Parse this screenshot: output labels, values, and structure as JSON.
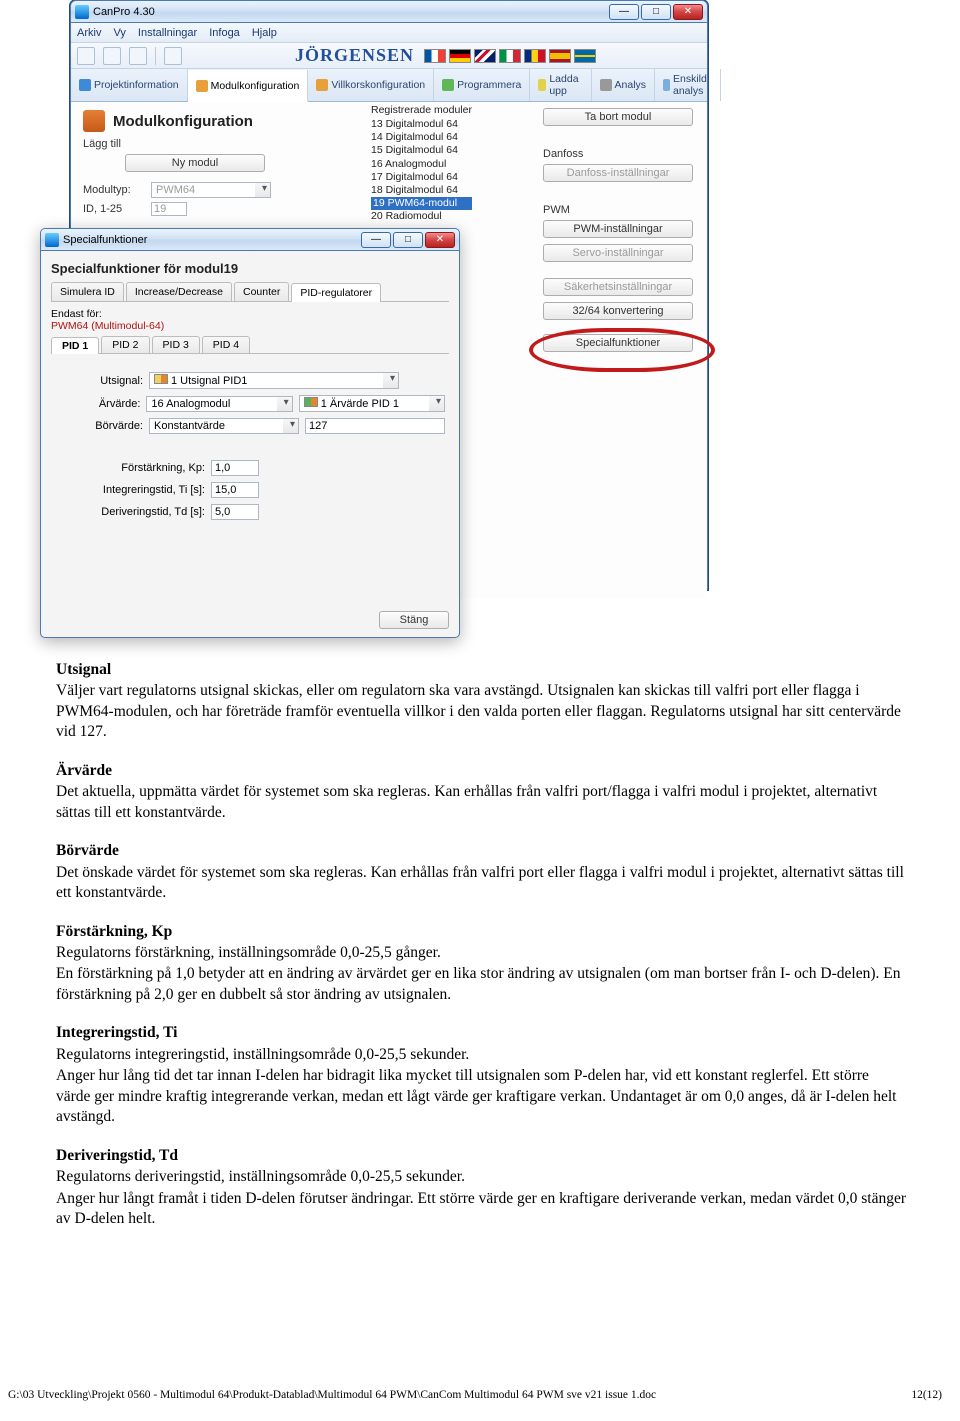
{
  "main_window": {
    "title": "CanPro 4.30",
    "menus": [
      "Arkiv",
      "Vy",
      "Installningar",
      "Infoga",
      "Hjalp"
    ],
    "brand": "JÖRGENSEN",
    "flags": [
      {
        "name": "france",
        "style": "linear-gradient(90deg,#0055a4 33%,#fff 33% 66%,#ef4135 66%)"
      },
      {
        "name": "germany",
        "style": "linear-gradient(#000 33%,#dd0000 33% 66%,#ffce00 66%)"
      },
      {
        "name": "uk",
        "style": "linear-gradient(135deg,#012169 25%,#fff 25% 35%,#c8102e 35% 50%,#fff 50% 65%,#012169 65%)"
      },
      {
        "name": "italy",
        "style": "linear-gradient(90deg,#009246 33%,#fff 33% 66%,#ce2b37 66%)"
      },
      {
        "name": "romania",
        "style": "linear-gradient(90deg,#002b7f 33%,#fcd116 33% 66%,#ce1126 66%)"
      },
      {
        "name": "spain",
        "style": "linear-gradient(#aa151b 25%,#f1bf00 25% 75%,#aa151b 75%)"
      },
      {
        "name": "sweden",
        "style": "linear-gradient(#006aa7 40%,#fecc00 40% 60%,#006aa7 60%)"
      }
    ],
    "main_tabs": [
      {
        "label": "Projektinformation",
        "icon": "ic-blue"
      },
      {
        "label": "Modulkonfiguration",
        "icon": "ic-orange",
        "selected": true
      },
      {
        "label": "Villkorskonfiguration",
        "icon": "ic-orange"
      },
      {
        "label": "Programmera",
        "icon": "ic-green"
      },
      {
        "label": "Ladda upp",
        "icon": "ic-yel"
      },
      {
        "label": "Analys",
        "icon": "ic-gray"
      },
      {
        "label": "Enskild analys",
        "icon": "ic-mag"
      }
    ],
    "page_title": "Modulkonfiguration",
    "add_label": "Lägg till",
    "new_module_btn": "Ny modul",
    "modultyp_label": "Modultyp:",
    "modultyp_value": "PWM64",
    "id_label": "ID, 1-25",
    "id_value": "19",
    "registered_header": "Registrerade moduler",
    "modules": [
      "13  Digitalmodul 64",
      "14  Digitalmodul 64",
      "15  Digitalmodul 64",
      "16  Analogmodul",
      "17  Digitalmodul 64",
      "18  Digitalmodul 64",
      "19  PWM64-modul",
      "20  Radiomodul"
    ],
    "selected_module_index": 6,
    "remove_btn": "Ta bort modul",
    "danfoss_label": "Danfoss",
    "danfoss_btn": "Danfoss-inställningar",
    "pwm_label": "PWM",
    "pwm_btn": "PWM-inställningar",
    "servo_btn": "Servo-inställningar",
    "safety_btn": "Säkerhetsinställningar",
    "conv_btn": "32/64 konvertering",
    "special_btn": "Specialfunktioner"
  },
  "dialog": {
    "title": "Specialfunktioner",
    "heading": "Specialfunktioner för modul19",
    "sub_tabs": [
      "Simulera ID",
      "Increase/Decrease",
      "Counter",
      "PID-regulatorer"
    ],
    "sub_tab_selected": 3,
    "restricted_label": "Endast för:",
    "restricted_value": "PWM64 (Multimodul-64)",
    "pid_tabs": [
      "PID 1",
      "PID 2",
      "PID 3",
      "PID 4"
    ],
    "pid_tab_selected": 0,
    "rows": {
      "utsignal_label": "Utsignal:",
      "utsignal_value": "1  Utsignal PID1",
      "arvarde_label": "Ärvärde:",
      "arvarde_src": "16 Analogmodul",
      "arvarde_sig": "1  Ärvärde PID 1",
      "borvarde_label": "Börvärde:",
      "borvarde_src": "Konstantvärde",
      "borvarde_val": "127",
      "kp_label": "Förstärkning, Kp:",
      "kp_val": "1,0",
      "ti_label": "Integreringstid, Ti [s]:",
      "ti_val": "15,0",
      "td_label": "Deriveringstid, Td [s]:",
      "td_val": "5,0"
    },
    "close_btn": "Stäng"
  },
  "doc": {
    "sections": [
      {
        "h": "Utsignal",
        "p": "Väljer vart regulatorns utsignal skickas, eller om regulatorn ska vara avstängd. Utsignalen kan skickas till valfri port eller flagga i PWM64-modulen, och har företräde framför eventuella villkor i den valda porten eller flaggan. Regulatorns utsignal har sitt centervärde vid 127."
      },
      {
        "h": "Ärvärde",
        "p": "Det aktuella, uppmätta värdet för systemet som ska regleras. Kan erhållas från valfri port/flagga i valfri modul i projektet, alternativt sättas till ett konstantvärde."
      },
      {
        "h": "Börvärde",
        "p": "Det önskade värdet för systemet som ska regleras. Kan erhållas från valfri port eller flagga i valfri modul i projektet, alternativt sättas till ett konstantvärde."
      },
      {
        "h": "Förstärkning, Kp",
        "p": "Regulatorns förstärkning, inställningsområde 0,0-25,5 gånger.\nEn förstärkning på 1,0 betyder att en ändring av ärvärdet ger en lika stor ändring av utsignalen (om man bortser från I- och D-delen). En förstärkning på 2,0 ger en dubbelt så stor ändring av utsignalen."
      },
      {
        "h": "Integreringstid, Ti",
        "p": "Regulatorns integreringstid, inställningsområde 0,0-25,5 sekunder.\nAnger hur lång tid det tar innan I-delen har bidragit lika mycket till utsignalen som P-delen har, vid ett konstant reglerfel. Ett större värde ger mindre kraftig integrerande verkan, medan ett lågt värde ger kraftigare verkan. Undantaget är om 0,0 anges, då är I-delen helt avstängd."
      },
      {
        "h": "Deriveringstid, Td",
        "p": "Regulatorns deriveringstid, inställningsområde 0,0-25,5 sekunder.\nAnger hur långt framåt i tiden D-delen förutser ändringar. Ett större värde ger en kraftigare deriverande verkan, medan värdet 0,0 stänger av D-delen helt."
      }
    ]
  },
  "footer_path": "G:\\03 Utveckling\\Projekt 0560 - Multimodul 64\\Produkt-Datablad\\Multimodul 64 PWM\\CanCom Multimodul 64 PWM sve v21 issue 1.doc",
  "footer_page": "12(12)"
}
